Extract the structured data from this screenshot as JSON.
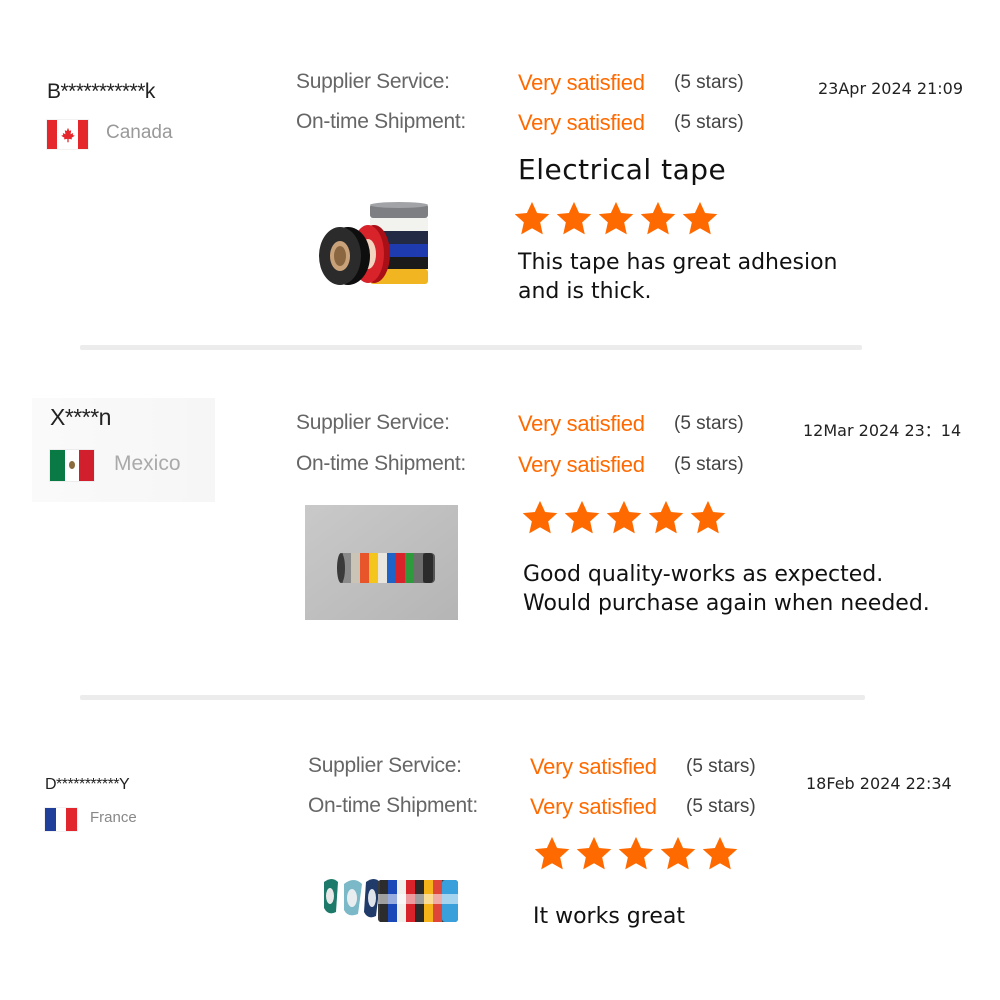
{
  "labels": {
    "supplier_service": "Supplier Service:",
    "ontime_shipment": "On-time Shipment:"
  },
  "colors": {
    "accent_orange": "#ff6a00",
    "star": "#ff6a00"
  },
  "reviews": [
    {
      "username": "B***********k",
      "country": "Canada",
      "flag": "canada-flag",
      "supplier_service": {
        "rating": "Very satisfied",
        "stars": "(5 stars)"
      },
      "ontime_shipment": {
        "rating": "Very satisfied",
        "stars": "(5 stars)"
      },
      "date": "23Apr 2024 21:09",
      "product_title": "Electrical tape",
      "star_count": 5,
      "comment_lines": [
        "This tape has great adhesion",
        "and is thick."
      ],
      "image": "electrical-tape-rolls-image"
    },
    {
      "username": "X****n",
      "country": "Mexico",
      "flag": "mexico-flag",
      "supplier_service": {
        "rating": "Very satisfied",
        "stars": "(5 stars)"
      },
      "ontime_shipment": {
        "rating": "Very satisfied",
        "stars": "(5 stars)"
      },
      "date": "12Mar 2024 23：14",
      "star_count": 5,
      "comment_lines": [
        "Good quality-works as expected.",
        "Would purchase again when needed."
      ],
      "image": "colored-tape-rolls-image"
    },
    {
      "username": "D***********Y",
      "country": "France",
      "flag": "france-flag",
      "supplier_service": {
        "rating": "Very satisfied",
        "stars": "(5 stars)"
      },
      "ontime_shipment": {
        "rating": "Very satisfied",
        "stars": "(5 stars)"
      },
      "date": "18Feb 2024 22:34",
      "star_count": 5,
      "comment_lines": [
        "It works great"
      ],
      "image": "tape-rolls-row-image"
    }
  ]
}
